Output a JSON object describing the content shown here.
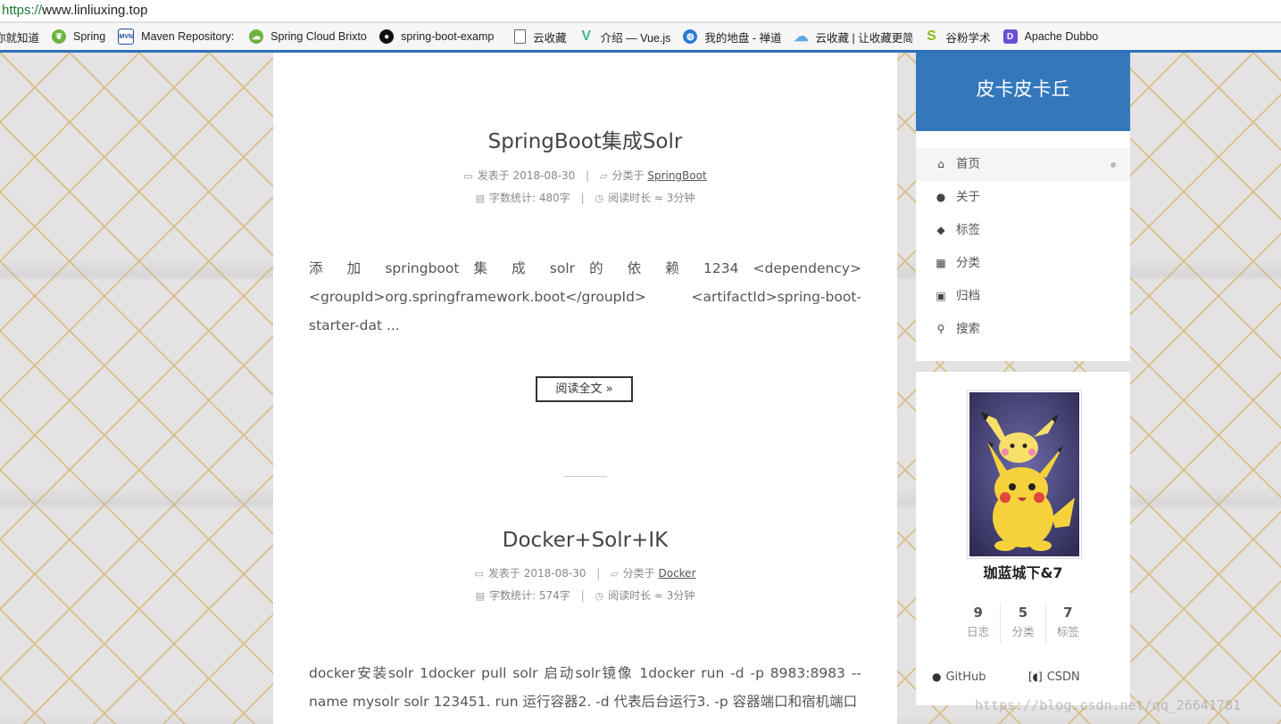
{
  "browser": {
    "url_scheme": "https://",
    "url_rest": "www.linliuxing.top"
  },
  "bookmarks": [
    {
      "label": "你就知道",
      "icon": "folder-icon"
    },
    {
      "label": "Spring",
      "icon": "spring-leaf-icon"
    },
    {
      "label": "Maven Repository:",
      "icon": "mvn-icon"
    },
    {
      "label": "Spring Cloud Brixto",
      "icon": "cloud-leaf-icon"
    },
    {
      "label": "spring-boot-examp",
      "icon": "github-icon"
    },
    {
      "label": "云收藏",
      "icon": "page-icon"
    },
    {
      "label": "介绍 — Vue.js",
      "icon": "vue-icon"
    },
    {
      "label": "我的地盘 - 禅道",
      "icon": "globe-icon"
    },
    {
      "label": "云收藏 | 让收藏更简",
      "icon": "cloud-icon"
    },
    {
      "label": "谷粉学术",
      "icon": "s-icon"
    },
    {
      "label": "Apache Dubbo",
      "icon": "dubbo-icon"
    }
  ],
  "posts": [
    {
      "title": "SpringBoot集成Solr",
      "published_prefix": "发表于",
      "published": "2018-08-30",
      "category_prefix": "分类于",
      "category": "SpringBoot",
      "wordcount": "字数统计: 480字",
      "readtime": "阅读时长 ≈ 3分钟",
      "excerpt_lines": [
        "添 加 springboot 集 成 solr 的 依 赖 1234 <dependency>",
        "<groupId>org.springframework.boot</groupId> <artifactId>spring-boot-",
        "starter-dat ..."
      ],
      "readmore": "阅读全文 »"
    },
    {
      "title": "Docker+Solr+IK",
      "published_prefix": "发表于",
      "published": "2018-08-30",
      "category_prefix": "分类于",
      "category": "Docker",
      "wordcount": "字数统计: 574字",
      "readtime": "阅读时长 ≈ 3分钟",
      "excerpt_lines": [
        "docker安装solr 1docker pull solr 启动solr镜像 1docker run -d -p 8983:8983 --",
        "name mysolr solr 123451. run 运行容器2. -d 代表后台运行3. -p 容器端口和宿机端口"
      ]
    }
  ],
  "sidebar": {
    "brand": "皮卡皮卡丘",
    "menu": [
      {
        "label": "首页",
        "icon": "home-icon",
        "symbol": "⌂"
      },
      {
        "label": "关于",
        "icon": "user-icon",
        "symbol": "●"
      },
      {
        "label": "标签",
        "icon": "tags-icon",
        "symbol": "◆"
      },
      {
        "label": "分类",
        "icon": "grid-icon",
        "symbol": "▦"
      },
      {
        "label": "归档",
        "icon": "archive-icon",
        "symbol": "▣"
      },
      {
        "label": "搜索",
        "icon": "search-icon",
        "symbol": "⚲"
      }
    ],
    "author": "珈蓝城下&7",
    "stats": [
      {
        "count": "9",
        "label": "日志"
      },
      {
        "count": "5",
        "label": "分类"
      },
      {
        "count": "7",
        "label": "标签"
      }
    ],
    "links": [
      {
        "label": "GitHub",
        "icon": "github-icon"
      },
      {
        "label": "CSDN",
        "icon": "csdn-icon"
      }
    ]
  },
  "watermark": "https://blog.csdn.net/qq_26641781",
  "colors": {
    "brand_bg": "#3478bb",
    "bookmark_bar_accent": "#2f6fba"
  }
}
